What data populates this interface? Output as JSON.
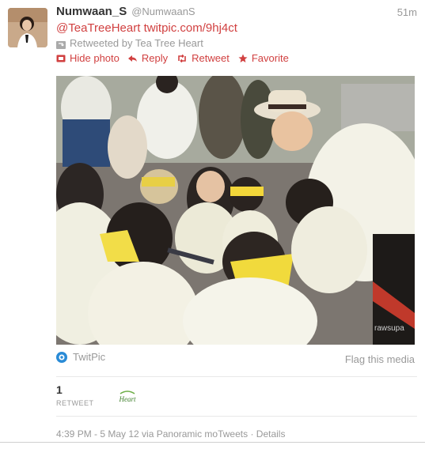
{
  "tweet": {
    "fullname": "Numwaan_S",
    "username": "@NumwaanS",
    "time": "51m",
    "mention": "@TeaTreeHeart",
    "link": "twitpic.com/9hj4ct",
    "retweeted_by": "Retweeted by Tea Tree Heart",
    "actions": {
      "hide_photo": "Hide photo",
      "reply": "Reply",
      "retweet": "Retweet",
      "favorite": "Favorite"
    }
  },
  "media": {
    "provider": "TwitPic",
    "flag": "Flag this media",
    "photo_print": "rawsupa"
  },
  "stats": {
    "retweet_count": "1",
    "retweet_label": "RETWEET",
    "mini_avatar_text": "Heart"
  },
  "meta": {
    "timestamp": "4:39 PM - 5 May 12 via Panoramic moTweets",
    "separator": " · ",
    "details": "Details"
  },
  "colors": {
    "link": "#d14040",
    "muted": "#999999",
    "text": "#333333",
    "twitpic_blue": "#2a8bd6"
  }
}
